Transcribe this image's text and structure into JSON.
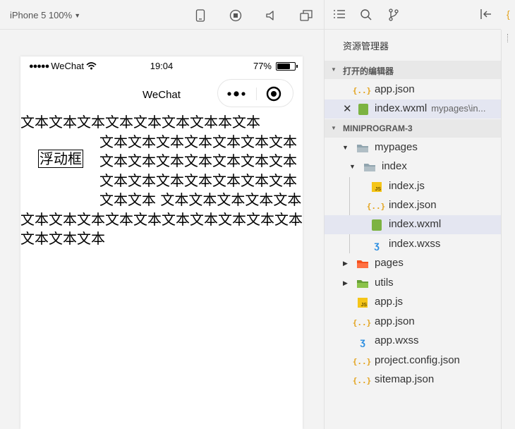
{
  "simulator": {
    "device": "iPhone 5 100%",
    "status_bar": {
      "carrier": "WeChat",
      "time": "19:04",
      "battery": "77%",
      "battery_level": 0.77
    },
    "nav_title": "WeChat",
    "float_box": "浮动框",
    "text_lines": [
      "文本文本文本文本文本文本文本本文本",
      "文本文本文本文本文本文本文本",
      "文本文本文本文本文本文本文本",
      "文本文本文本文本文本文本文本",
      "文本文本 文本文本文本文本文本",
      "文本文本文本文本文本文本文本文本文本文本",
      "文本文本文本"
    ]
  },
  "explorer": {
    "title": "资源管理器",
    "open_editors": {
      "label": "打开的编辑器",
      "items": [
        {
          "name": "app.json",
          "icon": "json-icon"
        },
        {
          "name": "index.wxml",
          "path": "mypages\\in...",
          "icon": "wxml-icon"
        }
      ]
    },
    "project": {
      "label": "MINIPROGRAM-3",
      "items": [
        {
          "name": "mypages",
          "icon": "folder-icon"
        },
        {
          "name": "index",
          "icon": "folder-icon"
        },
        {
          "name": "index.js",
          "icon": "js-icon"
        },
        {
          "name": "index.json",
          "icon": "json-icon"
        },
        {
          "name": "index.wxml",
          "icon": "wxml-icon"
        },
        {
          "name": "index.wxss",
          "icon": "wxss-icon"
        },
        {
          "name": "pages",
          "icon": "folder-icon"
        },
        {
          "name": "utils",
          "icon": "folder-icon"
        },
        {
          "name": "app.js",
          "icon": "js-icon"
        },
        {
          "name": "app.json",
          "icon": "json-icon"
        },
        {
          "name": "app.wxss",
          "icon": "wxss-icon"
        },
        {
          "name": "project.config.json",
          "icon": "json-icon"
        },
        {
          "name": "sitemap.json",
          "icon": "json-icon"
        }
      ]
    }
  },
  "colors": {
    "selected_row": "#e4e6f1",
    "json_icon": "#e3a21a",
    "js_icon": "#f5c518",
    "wxml_icon": "#7cb342",
    "wxss_icon": "#2a8de0",
    "pages_folder": "#f4511e",
    "utils_folder": "#7cb342"
  }
}
